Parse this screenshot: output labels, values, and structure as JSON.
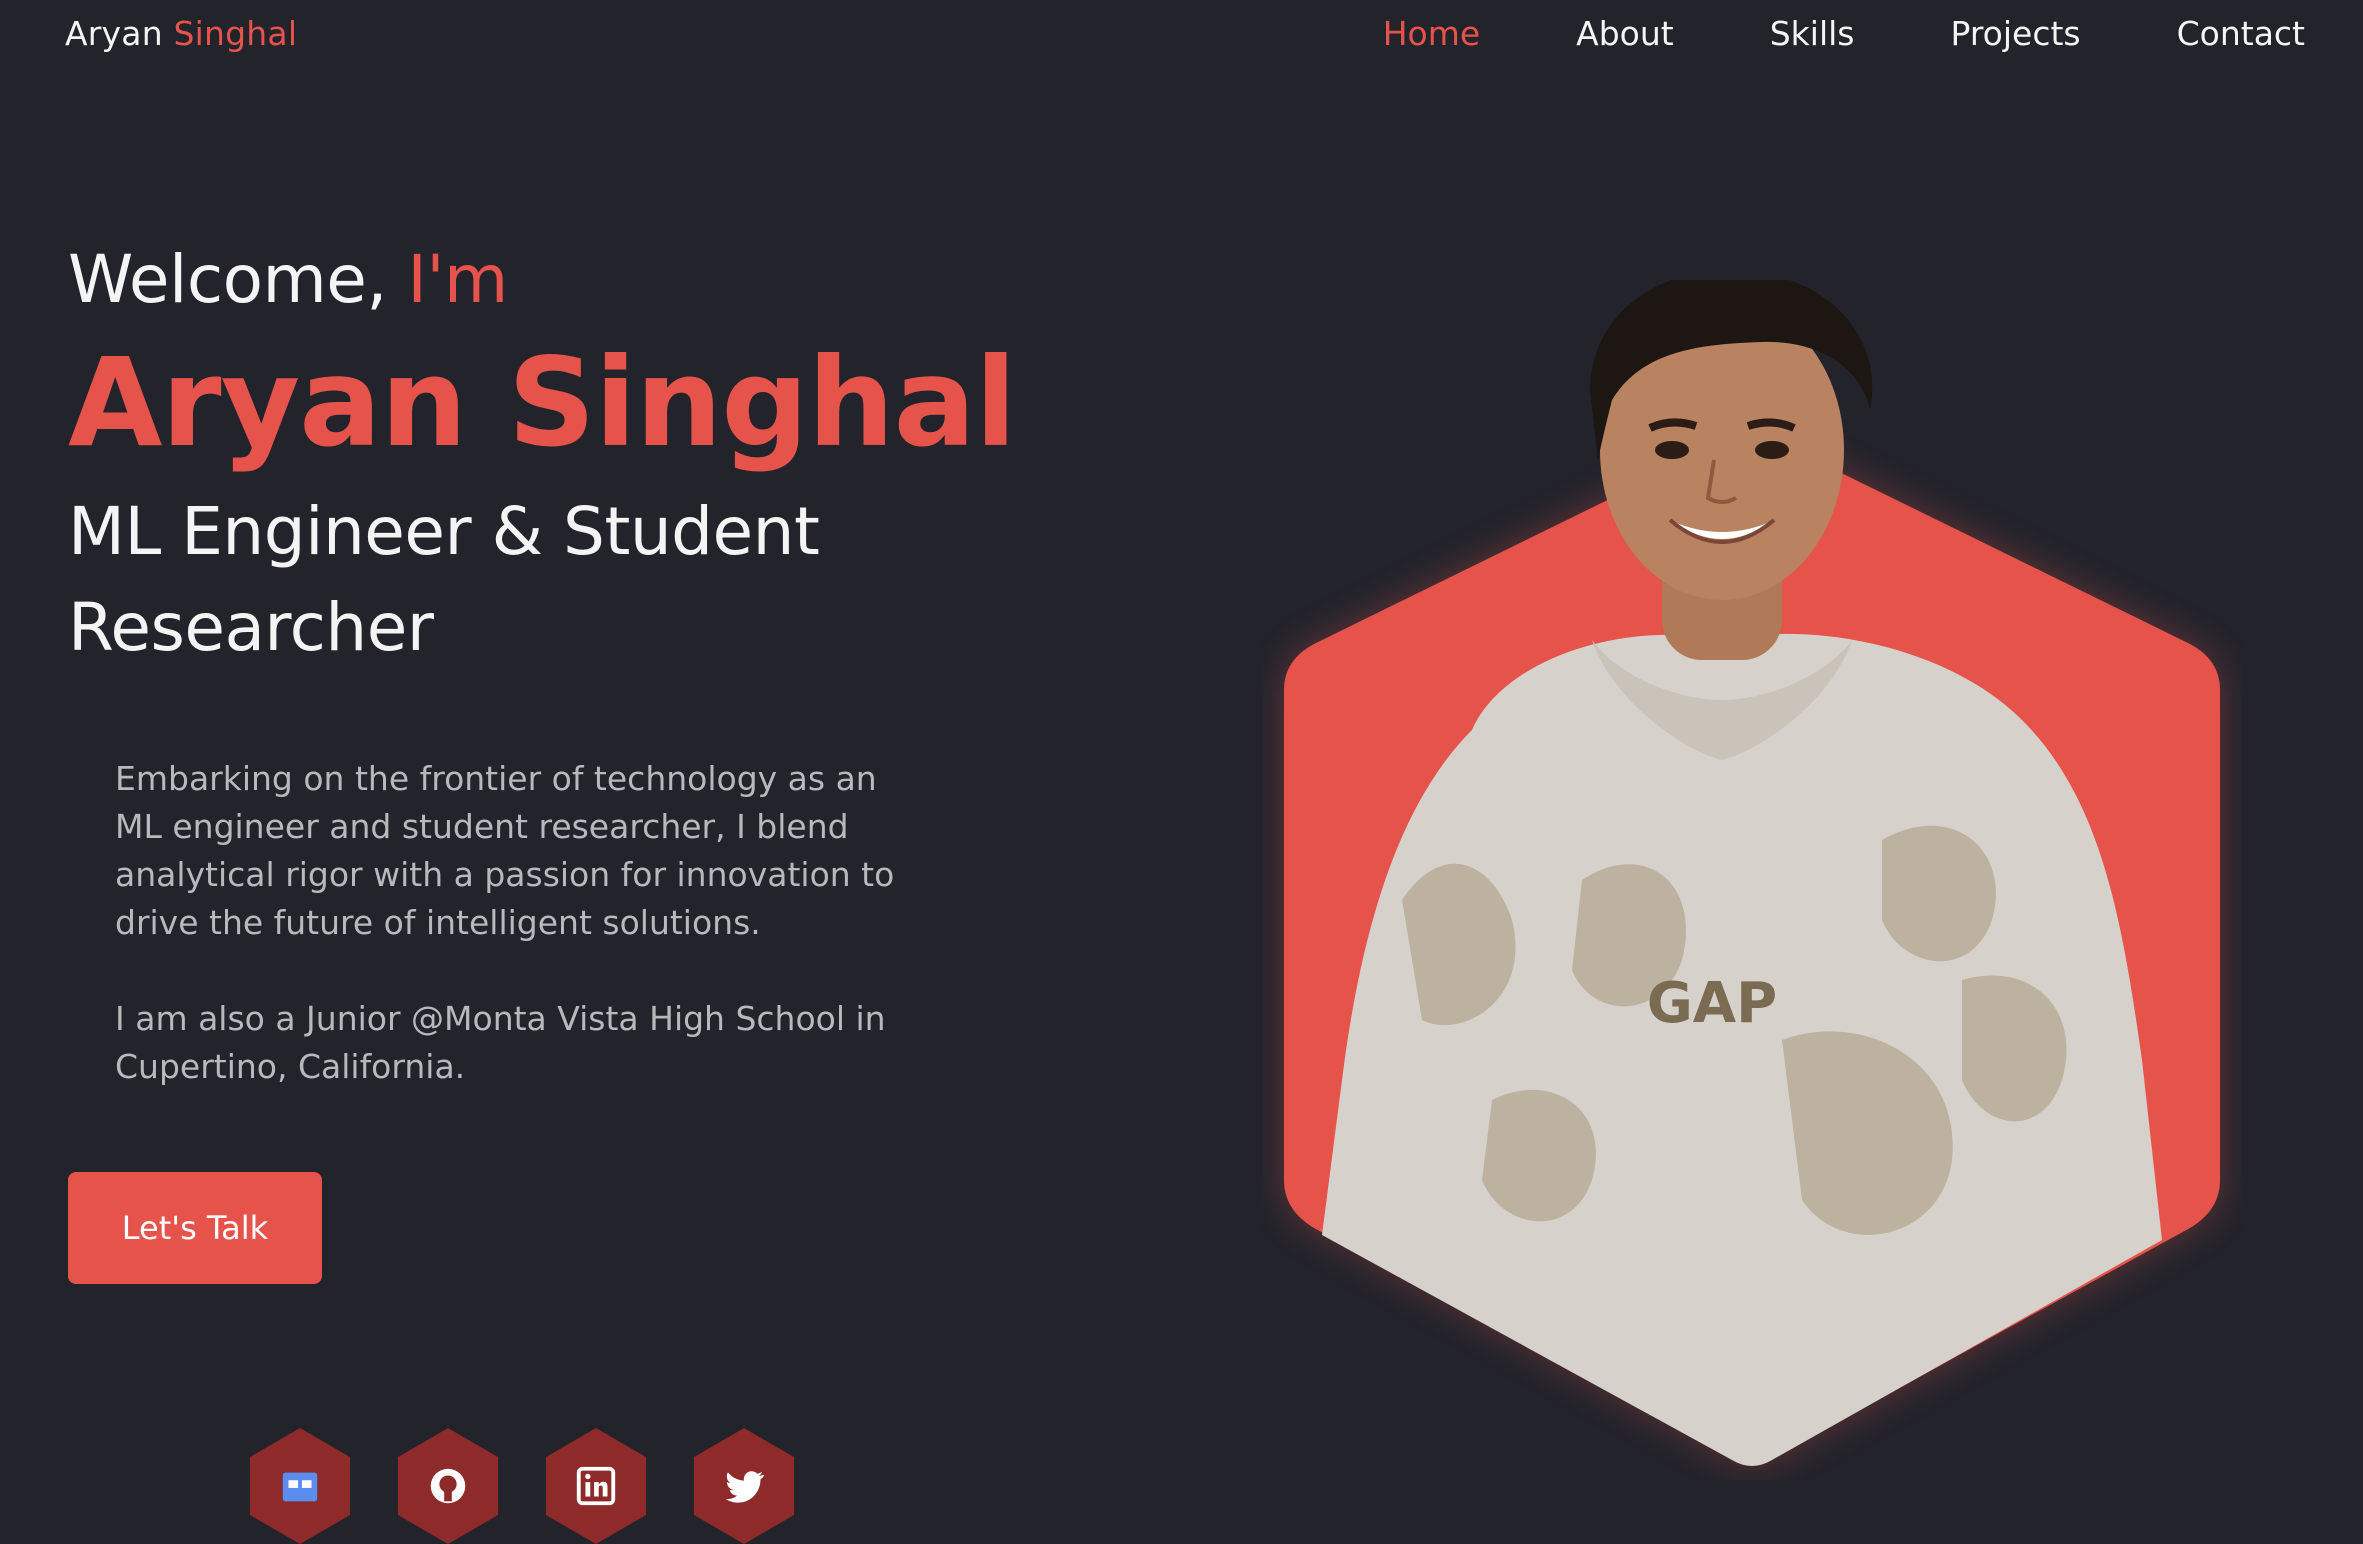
{
  "logo": {
    "first": "Aryan",
    "last": "Singhal"
  },
  "nav": {
    "home": "Home",
    "about": "About",
    "skills": "Skills",
    "projects": "Projects",
    "contact": "Contact"
  },
  "hero": {
    "welcome": "Welcome,",
    "welcome_accent": "I'm",
    "name": "Aryan Singhal",
    "role": "ML Engineer & Student Researcher",
    "description_1": "Embarking on the frontier of technology as an ML engineer and student researcher, I blend analytical rigor with a passion for innovation to drive the future of intelligent solutions.",
    "description_2": "I am also a Junior @Monta Vista High School in Cupertino, California.",
    "cta_label": "Let's Talk"
  },
  "photo": {
    "hoodie_text": "GAP"
  },
  "social": {
    "icons": [
      "devpost-icon",
      "github-icon",
      "linkedin-icon",
      "twitter-icon"
    ]
  },
  "colors": {
    "background": "#22232b",
    "accent": "#e5534b",
    "text": "#f4f4f4",
    "muted_text": "#b8b8bd",
    "social_bg": "#8e2a2a"
  }
}
